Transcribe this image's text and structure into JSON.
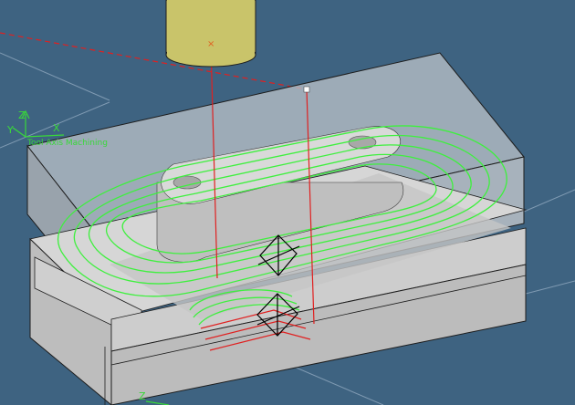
{
  "viewport": {
    "background_color": "#3e6381",
    "part_color": "#cfcfcf",
    "toolpath_color": "#3ef03e",
    "tool_color": "#c9c46a",
    "red_line_color": "#e02020"
  },
  "axis": {
    "z_label": "Z",
    "x_label": "X",
    "y_label": "Y",
    "name": "Tool Axis Machining",
    "bottom_label": "Z"
  }
}
